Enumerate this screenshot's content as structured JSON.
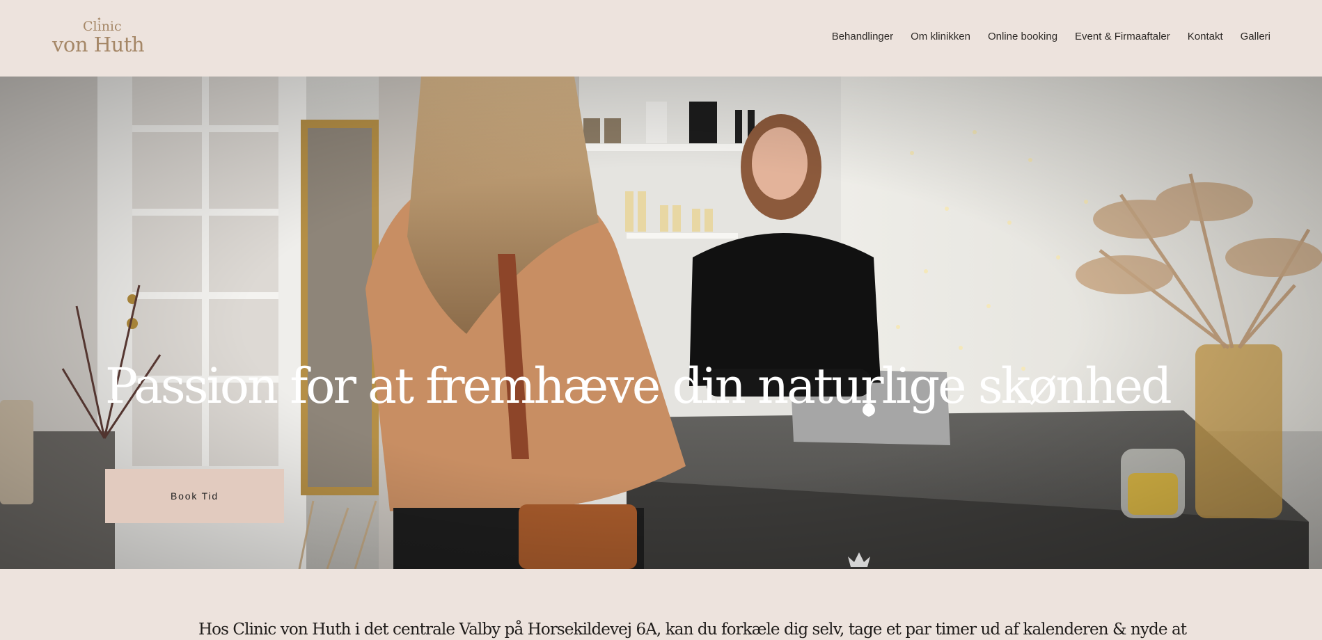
{
  "header": {
    "logo_top": "Clinic",
    "logo_bottom": "von Huth",
    "nav": [
      {
        "label": "Behandlinger"
      },
      {
        "label": "Om klinikken"
      },
      {
        "label": "Online booking"
      },
      {
        "label": "Event & Firmaaftaler"
      },
      {
        "label": "Kontakt"
      },
      {
        "label": "Galleri"
      }
    ]
  },
  "hero": {
    "title": "Passion for at fremhæve din naturlige skønhed",
    "cta": "Book Tid"
  },
  "intro": {
    "text": "Hos Clinic von Huth i det centrale Valby på Horsekildevej 6A, kan du forkæle dig selv, tage et par timer ud af kalenderen & nyde at"
  },
  "colors": {
    "background": "#ede3dd",
    "logo": "#a58767",
    "button": "#e2cbbf",
    "text": "#2e2a27"
  },
  "icons": {
    "logo_mark": "small-star-icon"
  }
}
